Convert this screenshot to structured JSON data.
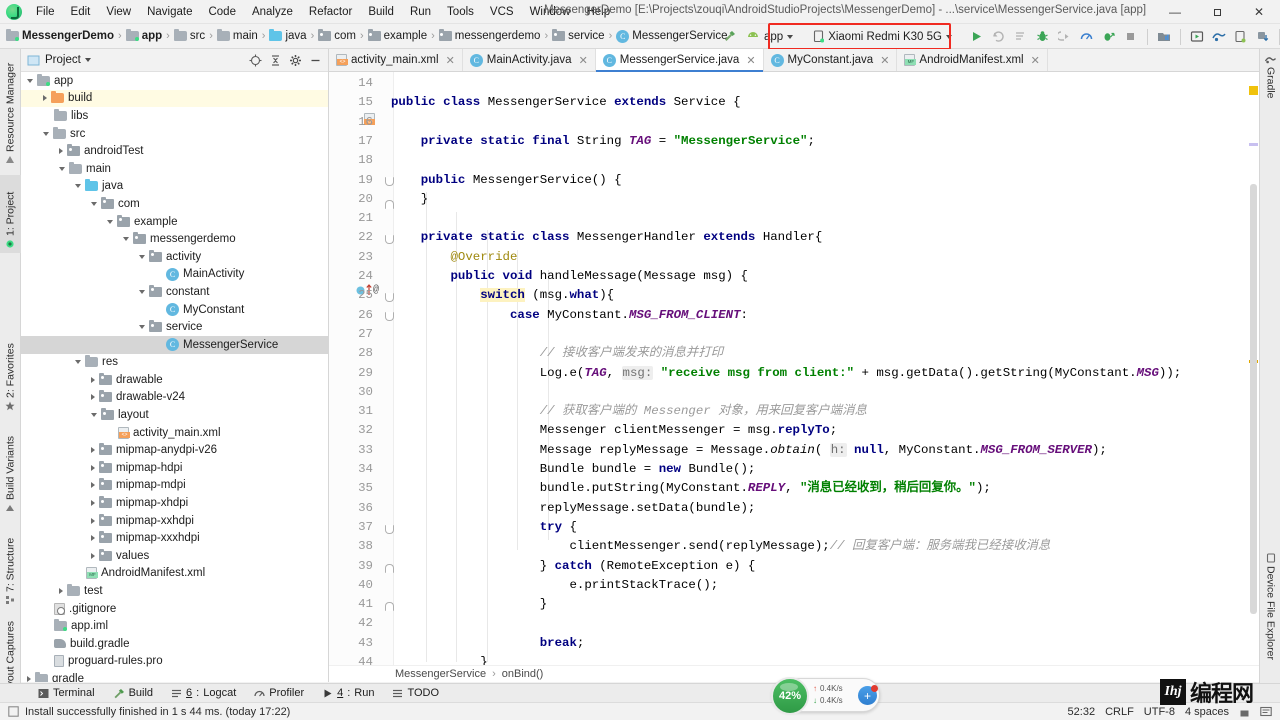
{
  "window": {
    "title": "MessengerDemo [E:\\Projects\\zouqi\\AndroidStudioProjects\\MessengerDemo] - ...\\service\\MessengerService.java [app]",
    "minimize": "—",
    "maximize": "❐",
    "close": "✕"
  },
  "menubar": {
    "items": [
      {
        "label": "File"
      },
      {
        "label": "Edit"
      },
      {
        "label": "View"
      },
      {
        "label": "Navigate"
      },
      {
        "label": "Code"
      },
      {
        "label": "Analyze"
      },
      {
        "label": "Refactor"
      },
      {
        "label": "Build"
      },
      {
        "label": "Run"
      },
      {
        "label": "Tools"
      },
      {
        "label": "VCS"
      },
      {
        "label": "Window"
      },
      {
        "label": "Help"
      }
    ]
  },
  "breadcrumbs": {
    "items": [
      {
        "label": "MessengerDemo",
        "icon": "module-icon",
        "bold": true
      },
      {
        "label": "app",
        "icon": "module-icon",
        "bold": true
      },
      {
        "label": "src",
        "icon": "folder-icon",
        "bold": false
      },
      {
        "label": "main",
        "icon": "folder-icon",
        "bold": false
      },
      {
        "label": "java",
        "icon": "folder-blue-icon",
        "bold": false
      },
      {
        "label": "com",
        "icon": "package-icon",
        "bold": false
      },
      {
        "label": "example",
        "icon": "package-icon",
        "bold": false
      },
      {
        "label": "messengerdemo",
        "icon": "package-icon",
        "bold": false
      },
      {
        "label": "service",
        "icon": "package-icon",
        "bold": false
      },
      {
        "label": "MessengerService",
        "icon": "class-icon",
        "bold": false
      }
    ],
    "separator": "›"
  },
  "toolbar": {
    "module_selector": "app",
    "device_selector": "Xiaomi Redmi K30 5G",
    "run_button": "run",
    "highlight_color": "#f02a21"
  },
  "left_strip": {
    "tabs": [
      {
        "label": "Resource Manager",
        "selected": false
      },
      {
        "label": "1: Project",
        "selected": true
      },
      {
        "label": "2: Favorites",
        "selected": false
      },
      {
        "label": "Build Variants",
        "selected": false
      },
      {
        "label": "7: Structure",
        "selected": false
      },
      {
        "label": "Layout Captures",
        "selected": false
      }
    ]
  },
  "right_strip": {
    "tabs": [
      {
        "label": "Gradle"
      },
      {
        "label": "Device File Explorer"
      }
    ]
  },
  "project_panel": {
    "title": "Project",
    "tree": [
      {
        "indent": 1,
        "twisty": "open",
        "icon": "module-icon",
        "label": "app",
        "state": "normal"
      },
      {
        "indent": 2,
        "twisty": "closed",
        "icon": "folder-orange-icon",
        "label": "build",
        "state": "highlight"
      },
      {
        "indent": 2,
        "twisty": "none",
        "icon": "folder-icon",
        "label": "libs",
        "state": "normal"
      },
      {
        "indent": 2,
        "twisty": "open",
        "icon": "folder-icon",
        "label": "src",
        "state": "normal"
      },
      {
        "indent": 3,
        "twisty": "closed",
        "icon": "package-icon",
        "label": "androidTest",
        "state": "normal"
      },
      {
        "indent": 3,
        "twisty": "open",
        "icon": "folder-icon",
        "label": "main",
        "state": "normal"
      },
      {
        "indent": 4,
        "twisty": "open",
        "icon": "folder-blue-icon",
        "label": "java",
        "state": "normal"
      },
      {
        "indent": 5,
        "twisty": "open",
        "icon": "package-icon",
        "label": "com",
        "state": "normal"
      },
      {
        "indent": 6,
        "twisty": "open",
        "icon": "package-icon",
        "label": "example",
        "state": "normal"
      },
      {
        "indent": 7,
        "twisty": "open",
        "icon": "package-icon",
        "label": "messengerdemo",
        "state": "normal"
      },
      {
        "indent": 8,
        "twisty": "open",
        "icon": "package-icon",
        "label": "activity",
        "state": "normal"
      },
      {
        "indent": 9,
        "twisty": "none",
        "icon": "class-icon",
        "label": "MainActivity",
        "state": "normal"
      },
      {
        "indent": 8,
        "twisty": "open",
        "icon": "package-icon",
        "label": "constant",
        "state": "normal"
      },
      {
        "indent": 9,
        "twisty": "none",
        "icon": "class-icon",
        "label": "MyConstant",
        "state": "normal"
      },
      {
        "indent": 8,
        "twisty": "open",
        "icon": "package-icon",
        "label": "service",
        "state": "normal"
      },
      {
        "indent": 9,
        "twisty": "none",
        "icon": "class-icon",
        "label": "MessengerService",
        "state": "selected"
      },
      {
        "indent": 4,
        "twisty": "open",
        "icon": "res-icon",
        "label": "res",
        "state": "normal"
      },
      {
        "indent": 5,
        "twisty": "closed",
        "icon": "package-icon",
        "label": "drawable",
        "state": "normal"
      },
      {
        "indent": 5,
        "twisty": "closed",
        "icon": "package-icon",
        "label": "drawable-v24",
        "state": "normal"
      },
      {
        "indent": 5,
        "twisty": "open",
        "icon": "package-icon",
        "label": "layout",
        "state": "normal"
      },
      {
        "indent": 6,
        "twisty": "none",
        "icon": "xml-icon",
        "label": "activity_main.xml",
        "state": "normal"
      },
      {
        "indent": 5,
        "twisty": "closed",
        "icon": "package-icon",
        "label": "mipmap-anydpi-v26",
        "state": "normal"
      },
      {
        "indent": 5,
        "twisty": "closed",
        "icon": "package-icon",
        "label": "mipmap-hdpi",
        "state": "normal"
      },
      {
        "indent": 5,
        "twisty": "closed",
        "icon": "package-icon",
        "label": "mipmap-mdpi",
        "state": "normal"
      },
      {
        "indent": 5,
        "twisty": "closed",
        "icon": "package-icon",
        "label": "mipmap-xhdpi",
        "state": "normal"
      },
      {
        "indent": 5,
        "twisty": "closed",
        "icon": "package-icon",
        "label": "mipmap-xxhdpi",
        "state": "normal"
      },
      {
        "indent": 5,
        "twisty": "closed",
        "icon": "package-icon",
        "label": "mipmap-xxxhdpi",
        "state": "normal"
      },
      {
        "indent": 5,
        "twisty": "closed",
        "icon": "package-icon",
        "label": "values",
        "state": "normal"
      },
      {
        "indent": 4,
        "twisty": "none",
        "icon": "manifest-icon",
        "label": "AndroidManifest.xml",
        "state": "normal"
      },
      {
        "indent": 3,
        "twisty": "closed",
        "icon": "folder-icon",
        "label": "test",
        "state": "normal"
      },
      {
        "indent": 2,
        "twisty": "none",
        "icon": "gitignore-icon",
        "label": ".gitignore",
        "state": "normal"
      },
      {
        "indent": 2,
        "twisty": "none",
        "icon": "module-icon",
        "label": "app.iml",
        "state": "normal"
      },
      {
        "indent": 2,
        "twisty": "none",
        "icon": "gradle-icon",
        "label": "build.gradle",
        "state": "normal"
      },
      {
        "indent": 2,
        "twisty": "none",
        "icon": "pro-icon",
        "label": "proguard-rules.pro",
        "state": "normal"
      },
      {
        "indent": 1,
        "twisty": "closed",
        "icon": "folder-icon",
        "label": "gradle",
        "state": "normal"
      }
    ]
  },
  "editor_tabs": [
    {
      "label": "activity_main.xml",
      "icon": "xml-icon",
      "active": false
    },
    {
      "label": "MainActivity.java",
      "icon": "class-icon",
      "active": false
    },
    {
      "label": "MessengerService.java",
      "icon": "class-icon",
      "active": true
    },
    {
      "label": "MyConstant.java",
      "icon": "class-icon",
      "active": false
    },
    {
      "label": "AndroidManifest.xml",
      "icon": "manifest-icon",
      "active": false
    }
  ],
  "editor_breadcrumb": {
    "class": "MessengerService",
    "separator": "›",
    "method": "onBind()"
  },
  "code": {
    "first_line": 14,
    "lines": [
      {
        "n": 14,
        "tokens": []
      },
      {
        "n": 15,
        "tokens": [
          {
            "t": "public ",
            "c": "kw"
          },
          {
            "t": "class ",
            "c": "kw"
          },
          {
            "t": "MessengerService ",
            "c": ""
          },
          {
            "t": "extends ",
            "c": "kw"
          },
          {
            "t": "Service {",
            "c": ""
          }
        ]
      },
      {
        "n": 16,
        "tokens": []
      },
      {
        "n": 17,
        "tokens": [
          {
            "t": "    ",
            "c": ""
          },
          {
            "t": "private static final ",
            "c": "kw"
          },
          {
            "t": "String ",
            "c": ""
          },
          {
            "t": "TAG",
            "c": "fld"
          },
          {
            "t": " = ",
            "c": ""
          },
          {
            "t": "\"MessengerService\"",
            "c": "str"
          },
          {
            "t": ";",
            "c": ""
          }
        ]
      },
      {
        "n": 18,
        "tokens": []
      },
      {
        "n": 19,
        "tokens": [
          {
            "t": "    ",
            "c": ""
          },
          {
            "t": "public ",
            "c": "kw"
          },
          {
            "t": "MessengerService() {",
            "c": ""
          }
        ]
      },
      {
        "n": 20,
        "tokens": [
          {
            "t": "    }",
            "c": ""
          }
        ]
      },
      {
        "n": 21,
        "tokens": []
      },
      {
        "n": 22,
        "tokens": [
          {
            "t": "    ",
            "c": ""
          },
          {
            "t": "private static class ",
            "c": "kw"
          },
          {
            "t": "MessengerHandler ",
            "c": ""
          },
          {
            "t": "extends ",
            "c": "kw"
          },
          {
            "t": "Handler{",
            "c": ""
          }
        ]
      },
      {
        "n": 23,
        "tokens": [
          {
            "t": "        ",
            "c": ""
          },
          {
            "t": "@Override",
            "c": "anno"
          }
        ]
      },
      {
        "n": 24,
        "tokens": [
          {
            "t": "        ",
            "c": ""
          },
          {
            "t": "public void ",
            "c": "kw"
          },
          {
            "t": "handleMessage(Message msg) {",
            "c": ""
          }
        ]
      },
      {
        "n": 25,
        "tokens": [
          {
            "t": "            ",
            "c": ""
          },
          {
            "t": "switch",
            "c": "kw hlsw"
          },
          {
            "t": " (msg.",
            "c": ""
          },
          {
            "t": "what",
            "c": "kw"
          },
          {
            "t": "){",
            "c": ""
          }
        ]
      },
      {
        "n": 26,
        "tokens": [
          {
            "t": "                ",
            "c": ""
          },
          {
            "t": "case ",
            "c": "kw"
          },
          {
            "t": "MyConstant.",
            "c": ""
          },
          {
            "t": "MSG_FROM_CLIENT",
            "c": "fld"
          },
          {
            "t": ":",
            "c": ""
          }
        ]
      },
      {
        "n": 27,
        "tokens": []
      },
      {
        "n": 28,
        "tokens": [
          {
            "t": "                    ",
            "c": ""
          },
          {
            "t": "// 接收客户端发来的消息并打印",
            "c": "cmt"
          }
        ]
      },
      {
        "n": 29,
        "tokens": [
          {
            "t": "                    ",
            "c": ""
          },
          {
            "t": "Log.",
            "c": ""
          },
          {
            "t": "e",
            "c": ""
          },
          {
            "t": "(",
            "c": ""
          },
          {
            "t": "TAG",
            "c": "fld"
          },
          {
            "t": ", ",
            "c": ""
          },
          {
            "t": "msg:",
            "c": "hintparam"
          },
          {
            "t": " ",
            "c": ""
          },
          {
            "t": "\"receive msg from client:\"",
            "c": "str"
          },
          {
            "t": " + msg.getData().getString(MyConstant.",
            "c": ""
          },
          {
            "t": "MSG",
            "c": "fld"
          },
          {
            "t": "));",
            "c": ""
          }
        ]
      },
      {
        "n": 30,
        "tokens": []
      },
      {
        "n": 31,
        "tokens": [
          {
            "t": "                    ",
            "c": ""
          },
          {
            "t": "// 获取客户端的 Messenger 对象，用来回复客户端消息",
            "c": "cmt"
          }
        ]
      },
      {
        "n": 32,
        "tokens": [
          {
            "t": "                    ",
            "c": ""
          },
          {
            "t": "Messenger clientMessenger = msg.",
            "c": ""
          },
          {
            "t": "replyTo",
            "c": "kw"
          },
          {
            "t": ";",
            "c": ""
          }
        ]
      },
      {
        "n": 33,
        "tokens": [
          {
            "t": "                    ",
            "c": ""
          },
          {
            "t": "Message replyMessage = Message.",
            "c": ""
          },
          {
            "t": "obtain",
            "c": "ital"
          },
          {
            "t": "( ",
            "c": ""
          },
          {
            "t": "h:",
            "c": "hintparam"
          },
          {
            "t": " ",
            "c": ""
          },
          {
            "t": "null",
            "c": "kw"
          },
          {
            "t": ", MyConstant.",
            "c": ""
          },
          {
            "t": "MSG_FROM_SERVER",
            "c": "fld"
          },
          {
            "t": ");",
            "c": ""
          }
        ]
      },
      {
        "n": 34,
        "tokens": [
          {
            "t": "                    ",
            "c": ""
          },
          {
            "t": "Bundle bundle = ",
            "c": ""
          },
          {
            "t": "new ",
            "c": "kw"
          },
          {
            "t": "Bundle();",
            "c": ""
          }
        ]
      },
      {
        "n": 35,
        "tokens": [
          {
            "t": "                    ",
            "c": ""
          },
          {
            "t": "bundle.putString(MyConstant.",
            "c": ""
          },
          {
            "t": "REPLY",
            "c": "fld"
          },
          {
            "t": ", ",
            "c": ""
          },
          {
            "t": "\"消息已经收到，稍后回复你。\"",
            "c": "str"
          },
          {
            "t": ");",
            "c": ""
          }
        ]
      },
      {
        "n": 36,
        "tokens": [
          {
            "t": "                    ",
            "c": ""
          },
          {
            "t": "replyMessage.setData(bundle);",
            "c": ""
          }
        ]
      },
      {
        "n": 37,
        "tokens": [
          {
            "t": "                    ",
            "c": ""
          },
          {
            "t": "try",
            "c": "kw"
          },
          {
            "t": " {",
            "c": ""
          }
        ]
      },
      {
        "n": 38,
        "tokens": [
          {
            "t": "                        ",
            "c": ""
          },
          {
            "t": "clientMessenger.send(replyMessage);",
            "c": ""
          },
          {
            "t": "// 回复客户端：服务端我已经接收消息",
            "c": "cmt"
          }
        ]
      },
      {
        "n": 39,
        "tokens": [
          {
            "t": "                    } ",
            "c": ""
          },
          {
            "t": "catch",
            "c": "kw"
          },
          {
            "t": " (RemoteException e) {",
            "c": ""
          }
        ]
      },
      {
        "n": 40,
        "tokens": [
          {
            "t": "                        ",
            "c": ""
          },
          {
            "t": "e.printStackTrace();",
            "c": ""
          }
        ]
      },
      {
        "n": 41,
        "tokens": [
          {
            "t": "                    }",
            "c": ""
          }
        ]
      },
      {
        "n": 42,
        "tokens": []
      },
      {
        "n": 43,
        "tokens": [
          {
            "t": "                    ",
            "c": ""
          },
          {
            "t": "break",
            "c": "kw"
          },
          {
            "t": ";",
            "c": ""
          }
        ]
      },
      {
        "n": 44,
        "tokens": [
          {
            "t": "            }",
            "c": ""
          }
        ]
      }
    ]
  },
  "bottom_bar": {
    "buttons": [
      {
        "label": "Terminal",
        "icon": "terminal-icon",
        "mnemonic": ""
      },
      {
        "label": "Build",
        "icon": "hammer-icon",
        "mnemonic": ""
      },
      {
        "label": "Logcat",
        "icon": "logcat-icon",
        "mnemonic": "6"
      },
      {
        "label": "Profiler",
        "icon": "profiler-icon",
        "mnemonic": ""
      },
      {
        "label": "Run",
        "icon": "run-icon",
        "mnemonic": "4"
      },
      {
        "label": "TODO",
        "icon": "todo-icon",
        "mnemonic": ""
      }
    ]
  },
  "status_bar": {
    "message": "Install successfully finished in 1 s 44 ms. (today 17:22)",
    "caret": "52:32",
    "line_separator": "CRLF",
    "encoding": "UTF-8",
    "indent": "4 spaces"
  },
  "net_widget": {
    "percent": "42%",
    "upload": "0.4K/s",
    "download": "0.4K/s",
    "up_arrow": "↑",
    "down_arrow": "↓",
    "plus": "+"
  },
  "watermark": {
    "mark": "Ihj",
    "text": "编程网"
  }
}
